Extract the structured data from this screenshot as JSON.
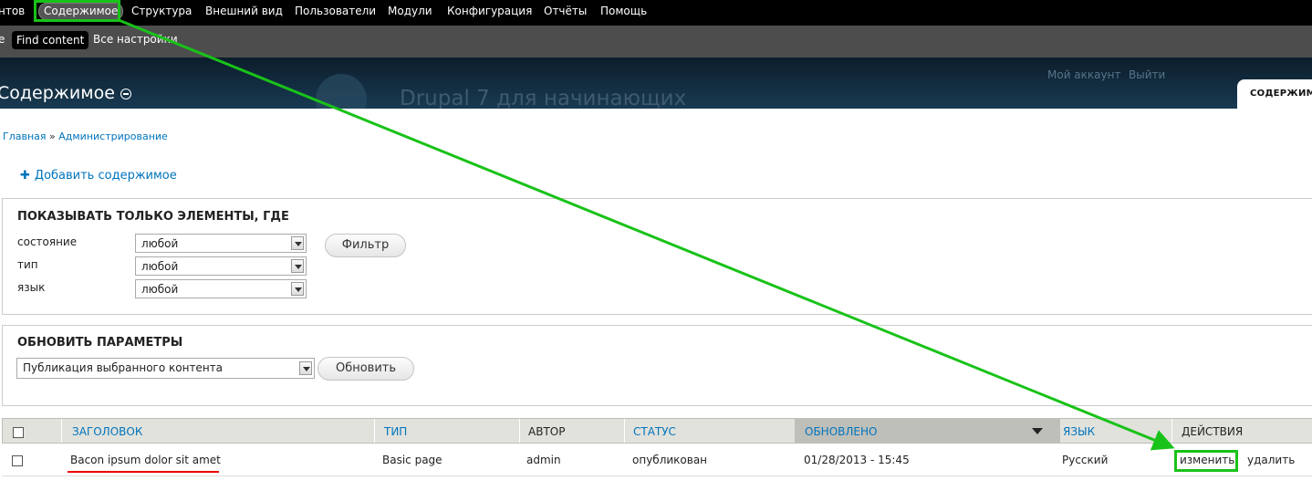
{
  "toolbar": {
    "items": [
      "нтов",
      "Содержимое",
      "Структура",
      "Внешний вид",
      "Пользователи",
      "Модули",
      "Конфигурация",
      "Отчёты",
      "Помощь"
    ]
  },
  "shortcuts": {
    "items": [
      "e",
      "Find content",
      "Все настройки"
    ]
  },
  "header": {
    "site_name": "Drupal 7 для начинающих",
    "account": "Мой аккаунт",
    "logout": "Выйти",
    "page_title": "Содержимое",
    "primary_tab": "СОДЕРЖИМ"
  },
  "breadcrumb": {
    "home": "Главная",
    "separator": "»",
    "admin": "Администрирование"
  },
  "actions": {
    "add_content": "Добавить содержимое"
  },
  "filter": {
    "legend": "ПОКАЗЫВАТЬ ТОЛЬКО ЭЛЕМЕНТЫ, ГДЕ",
    "status_label": "состояние",
    "status_value": "любой",
    "type_label": "тип",
    "type_value": "любой",
    "lang_label": "язык",
    "lang_value": "любой",
    "submit": "Фильтр"
  },
  "update": {
    "legend": "ОБНОВИТЬ ПАРАМЕТРЫ",
    "operation_value": "Публикация выбранного контента",
    "submit": "Обновить"
  },
  "table": {
    "headers": {
      "title": "ЗАГОЛОВОК",
      "type": "ТИП",
      "author": "АВТОР",
      "status": "СТАТУС",
      "updated": "ОБНОВЛЕНО",
      "language": "ЯЗЫК",
      "operations": "ДЕЙСТВИЯ"
    },
    "rows": [
      {
        "title": "Bacon ipsum dolor sit amet",
        "type": "Basic page",
        "author": "admin",
        "status": "опубликован",
        "updated": "01/28/2013 - 15:45",
        "language": "Русский",
        "edit": "изменить",
        "delete": "удалить"
      }
    ]
  },
  "colors": {
    "annotation_green": "#19c219",
    "annotation_red": "#e00000",
    "link": "#0074bd"
  }
}
